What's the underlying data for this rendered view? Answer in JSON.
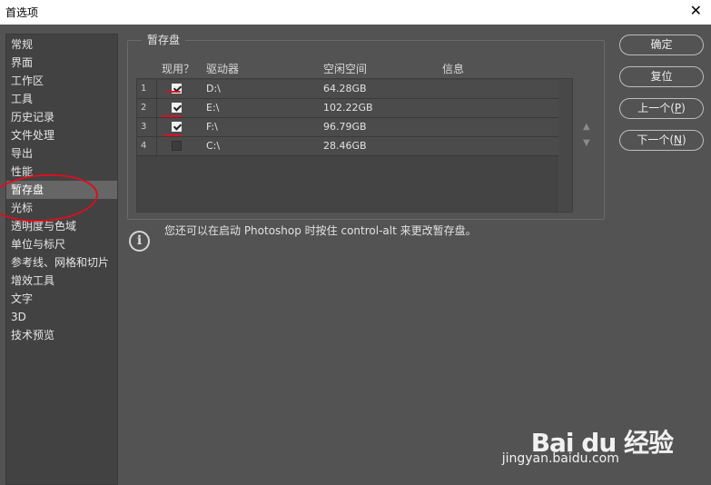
{
  "window": {
    "title": "首选项",
    "close_label": "✕"
  },
  "sidebar": {
    "items": [
      {
        "label": "常规"
      },
      {
        "label": "界面"
      },
      {
        "label": "工作区"
      },
      {
        "label": "工具"
      },
      {
        "label": "历史记录"
      },
      {
        "label": "文件处理"
      },
      {
        "label": "导出"
      },
      {
        "label": "性能"
      },
      {
        "label": "暂存盘",
        "selected": true
      },
      {
        "label": "光标"
      },
      {
        "label": "透明度与色域"
      },
      {
        "label": "单位与标尺"
      },
      {
        "label": "参考线、网格和切片"
      },
      {
        "label": "增效工具"
      },
      {
        "label": "文字"
      },
      {
        "label": "3D"
      },
      {
        "label": "技术预览"
      }
    ]
  },
  "scratch": {
    "group_title": "暂存盘",
    "columns": {
      "active": "现用？",
      "drive": "驱动器",
      "free": "空闲空间",
      "info": "信息"
    },
    "rows": [
      {
        "num": "1",
        "checked": true,
        "drive": "D:\\",
        "free": "64.28GB",
        "info": ""
      },
      {
        "num": "2",
        "checked": true,
        "drive": "E:\\",
        "free": "102.22GB",
        "info": ""
      },
      {
        "num": "3",
        "checked": true,
        "drive": "F:\\",
        "free": "96.79GB",
        "info": ""
      },
      {
        "num": "4",
        "checked": false,
        "drive": "C:\\",
        "free": "28.46GB",
        "info": ""
      }
    ],
    "up_arrow": "▲",
    "down_arrow": "▼"
  },
  "info": {
    "icon": "i",
    "text": "您还可以在启动 Photoshop 时按住 control-alt 来更改暂存盘。"
  },
  "buttons": {
    "ok": "确定",
    "reset": "复位",
    "prev_label": "上一个(",
    "prev_key": "P",
    "next_label": "下一个(",
    "next_key": "N",
    "paren_close": ")"
  },
  "watermark": {
    "brand": "Bai du 经验",
    "url": "jingyan.baidu.com"
  },
  "colors": {
    "annotation": "#d8101f",
    "selected_bg": "#666666"
  }
}
